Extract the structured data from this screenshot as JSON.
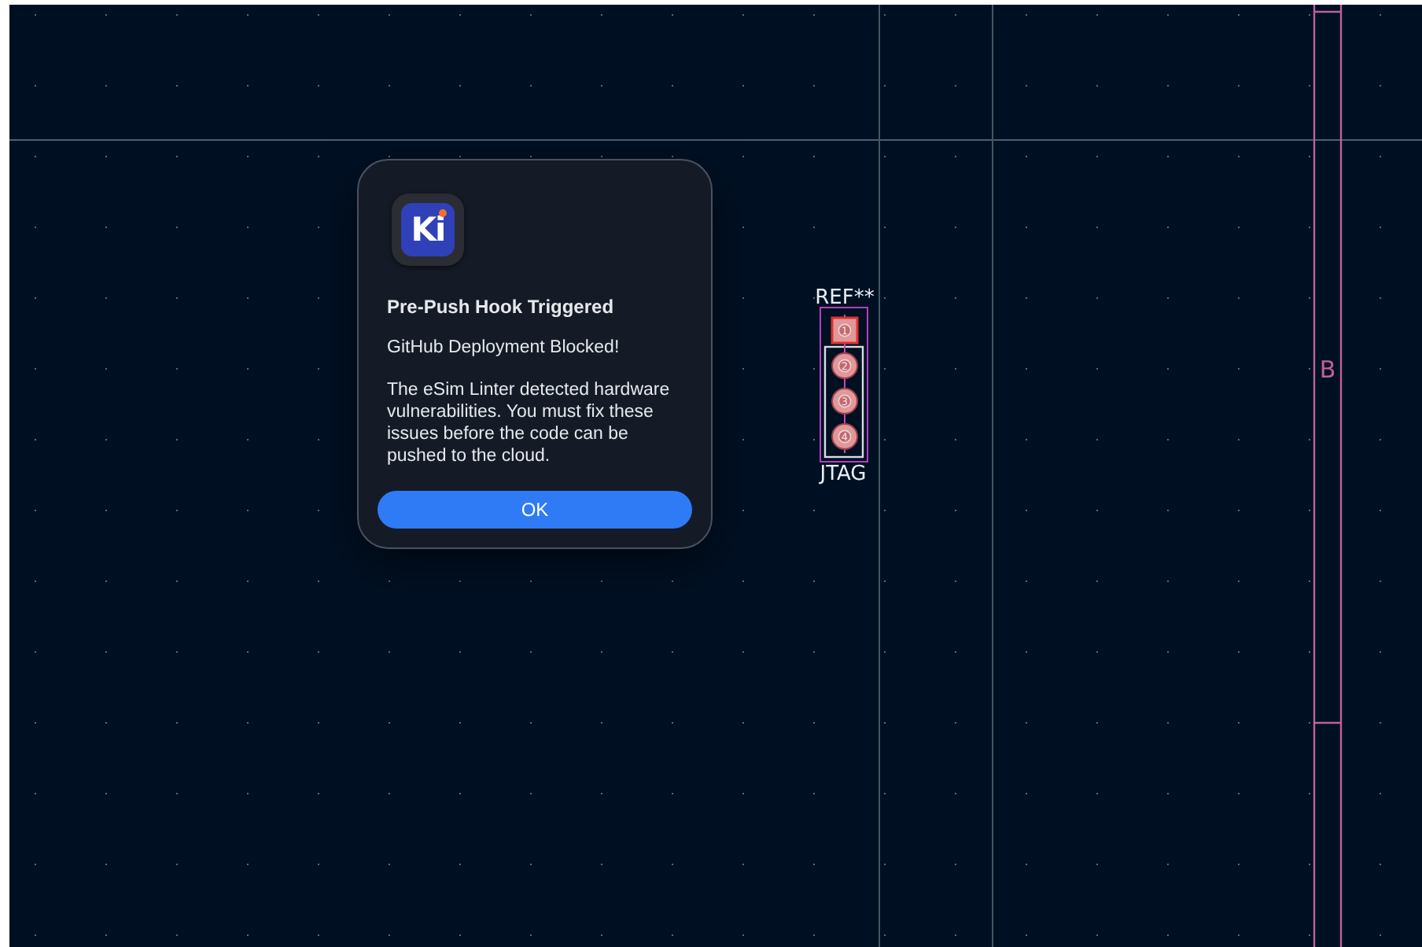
{
  "canvas": {
    "footprint": {
      "reference": "REF**",
      "value": "JTAG",
      "pads": [
        {
          "number": "1",
          "kind": "square"
        },
        {
          "number": "2",
          "kind": "round"
        },
        {
          "number": "3",
          "kind": "round"
        },
        {
          "number": "4",
          "kind": "round"
        }
      ]
    },
    "frame_label": "B"
  },
  "dialog": {
    "app_icon": "Ki",
    "title": "Pre-Push Hook Triggered",
    "subtitle": "GitHub Deployment Blocked!",
    "message": "The eSim Linter detected hardware vulnerabilities. You must fix these issues before the code can be pushed to the cloud.",
    "buttons": [
      {
        "label": "OK"
      }
    ]
  }
}
